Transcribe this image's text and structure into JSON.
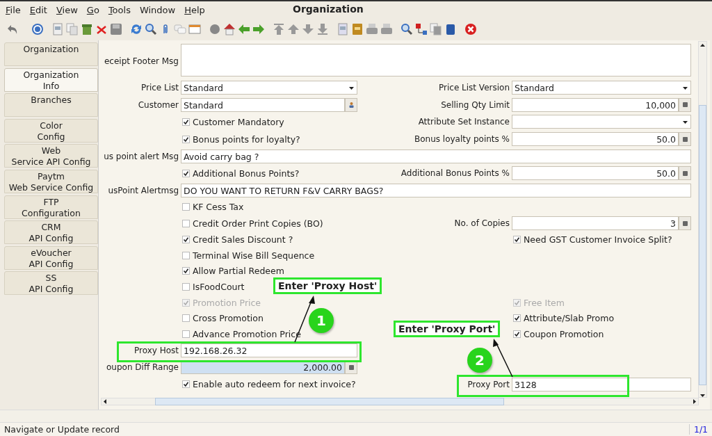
{
  "menu": [
    {
      "label": "File",
      "mnemonic": true
    },
    {
      "label": "Edit",
      "mnemonic": true
    },
    {
      "label": "View",
      "mnemonic": true
    },
    {
      "label": "Go",
      "mnemonic": true
    },
    {
      "label": "Tools",
      "mnemonic": true
    },
    {
      "label": "Window",
      "mnemonic": false
    },
    {
      "label": "Help",
      "mnemonic": true
    }
  ],
  "window": {
    "title": "Organization"
  },
  "sidebar": {
    "tabs": [
      {
        "label": "Organization",
        "selected": false
      },
      {
        "label": "Organization\nInfo",
        "selected": true
      },
      {
        "label": "Branches",
        "selected": false
      },
      {
        "label": "Color\nConfig",
        "selected": false
      },
      {
        "label": "Web\nService API Config",
        "selected": false
      },
      {
        "label": "Paytm\nWeb Service Config",
        "selected": false
      },
      {
        "label": "FTP\nConfiguration",
        "selected": false
      },
      {
        "label": "CRM\nAPI Config",
        "selected": false
      },
      {
        "label": "eVoucher\nAPI Config",
        "selected": false
      },
      {
        "label": "SS\nAPI Config",
        "selected": false
      }
    ]
  },
  "form": {
    "rows": [
      {
        "wide": {
          "kind": "textarea",
          "label": "eceipt Footer Msg"
        }
      },
      {
        "left": {
          "kind": "select",
          "label": "Price List",
          "value": "Standard",
          "mandatory": false
        },
        "right": {
          "kind": "select",
          "label": "Price List Version",
          "value": "Standard",
          "mandatory": false
        }
      },
      {
        "left": {
          "kind": "search",
          "label": "Customer",
          "value": "Standard",
          "mandatory": false
        },
        "right": {
          "kind": "number",
          "label": "Selling Qty Limit",
          "value": "10,000",
          "mandatory": false
        }
      },
      {
        "left": {
          "kind": "checkbox",
          "label": "Customer Mandatory",
          "checked": true,
          "disabled": false
        },
        "right": {
          "kind": "select",
          "label": "Attribute Set Instance",
          "mandatory": false
        }
      },
      {
        "left": {
          "kind": "checkbox",
          "label": "Bonus points for loyalty?",
          "checked": true,
          "disabled": false
        },
        "right": {
          "kind": "number",
          "label": "Bonus loyalty points %",
          "value": "50.0",
          "mandatory": false
        }
      },
      {
        "wide": {
          "kind": "text",
          "label": "us point alert Msg",
          "value": "Avoid carry bag ?",
          "mandatory": false
        }
      },
      {
        "left": {
          "kind": "checkbox",
          "label": "Additional Bonus Points?",
          "checked": true,
          "disabled": false
        },
        "right": {
          "kind": "number",
          "label": "Additional Bonus Points %",
          "value": "50.0",
          "mandatory": false
        }
      },
      {
        "wide": {
          "kind": "text",
          "label": "usPoint Alertmsg",
          "value": "DO YOU WANT TO RETURN F&V CARRY BAGS?",
          "mandatory": false
        }
      },
      {
        "left": {
          "kind": "checkbox",
          "label": "KF Cess Tax",
          "checked": false,
          "disabled": false
        }
      },
      {
        "left": {
          "kind": "checkbox",
          "label": "Credit Order Print Copies (BO)",
          "checked": false,
          "disabled": false
        },
        "right": {
          "kind": "number",
          "label": "No. of Copies",
          "value": "3",
          "mandatory": false
        }
      },
      {
        "left": {
          "kind": "checkbox",
          "label": "Credit Sales Discount ?",
          "checked": true,
          "disabled": false
        },
        "right": {
          "kind": "checkbox",
          "label": "Need GST Customer Invoice Split?",
          "checked": true,
          "disabled": false
        }
      },
      {
        "left": {
          "kind": "checkbox",
          "label": "Terminal Wise Bill Sequence",
          "checked": false,
          "disabled": false
        }
      },
      {
        "left": {
          "kind": "checkbox",
          "label": "Allow Partial Redeem",
          "checked": true,
          "disabled": false
        }
      },
      {
        "left": {
          "kind": "checkbox",
          "label": "IsFoodCourt",
          "checked": false,
          "disabled": false
        }
      },
      {
        "left": {
          "kind": "checkbox",
          "label": "Promotion Price",
          "checked": true,
          "disabled": true
        },
        "right": {
          "kind": "checkbox",
          "label": "Free Item",
          "checked": true,
          "disabled": true
        }
      },
      {
        "left": {
          "kind": "checkbox",
          "label": "Cross Promotion",
          "checked": false,
          "disabled": false
        },
        "right": {
          "kind": "checkbox",
          "label": "Attribute/Slab Promo",
          "checked": true,
          "disabled": false
        }
      },
      {
        "left": {
          "kind": "checkbox",
          "label": "Advance Promotion Price",
          "checked": false,
          "disabled": false
        },
        "right": {
          "kind": "checkbox",
          "label": "Coupon Promotion",
          "checked": true,
          "disabled": false
        }
      },
      {
        "left": {
          "kind": "text",
          "label": "Proxy Host",
          "value": "192.168.26.32",
          "mandatory": false
        }
      },
      {
        "left": {
          "kind": "number",
          "label": "oupon Diff Range",
          "value": "2,000.00",
          "mandatory": true
        }
      },
      {
        "left": {
          "kind": "checkbox",
          "label": "Enable auto redeem for next invoice?",
          "checked": true,
          "disabled": false
        },
        "right": {
          "kind": "text",
          "label": "Proxy Port",
          "value": "3128",
          "mandatory": false
        }
      }
    ]
  },
  "annotations": [
    {
      "number": "1",
      "text": "Enter 'Proxy Host'"
    },
    {
      "number": "2",
      "text": "Enter 'Proxy Port'"
    }
  ],
  "status_bar": {
    "message": "Navigate or Update record",
    "record": "1/1"
  }
}
